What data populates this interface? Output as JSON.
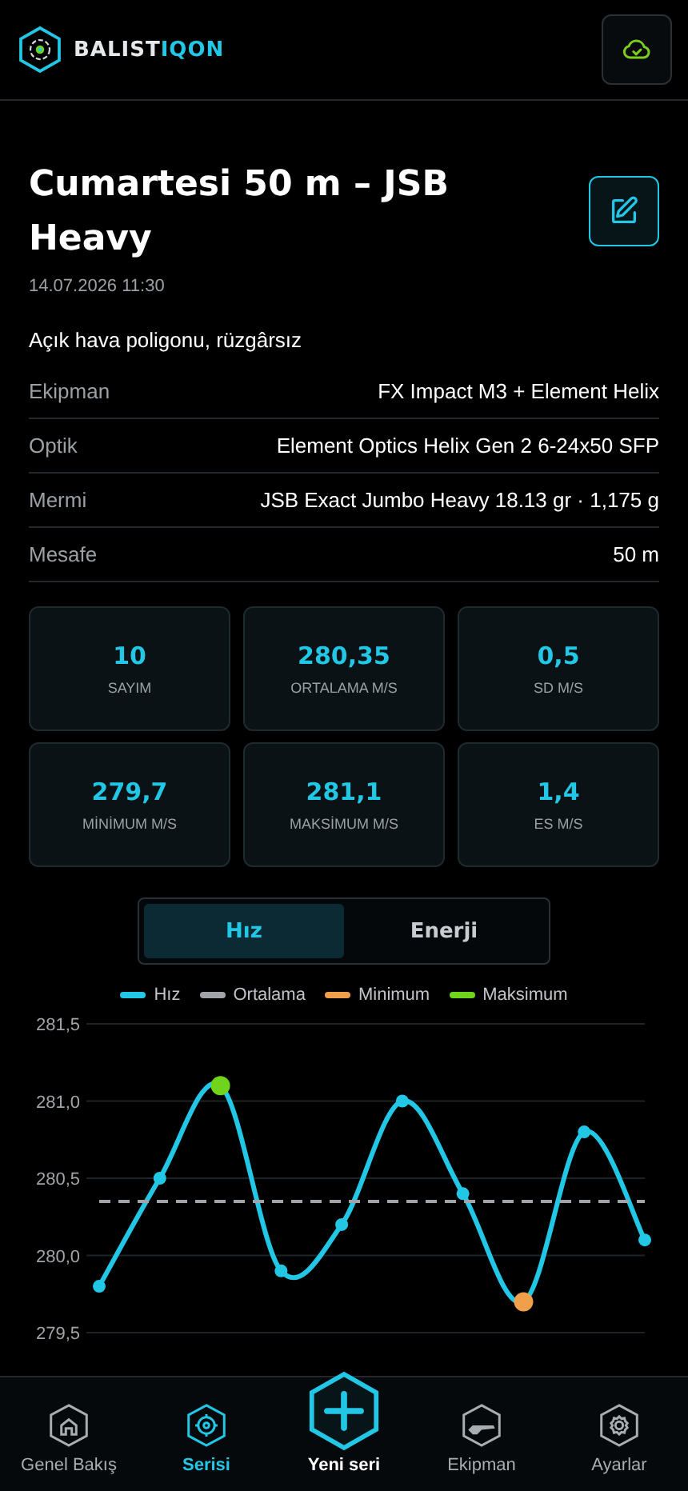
{
  "header": {
    "logo_text": "BALIST",
    "logo_accent": "IQON"
  },
  "session": {
    "title": "Cumartesi 50 m – JSB Heavy",
    "datetime": "14.07.2026 11:30",
    "note": "Açık hava poligonu, rüzgârsız"
  },
  "details": [
    {
      "label": "Ekipman",
      "value": "FX Impact M3 + Element Helix"
    },
    {
      "label": "Optik",
      "value": "Element Optics Helix Gen 2 6-24x50 SFP"
    },
    {
      "label": "Mermi",
      "value": "JSB Exact Jumbo Heavy 18.13 gr · 1,175 g"
    },
    {
      "label": "Mesafe",
      "value": "50 m"
    }
  ],
  "stats": [
    {
      "value": "10",
      "label": "SAYIM"
    },
    {
      "value": "280,35",
      "label": "ORTALAMA M/S"
    },
    {
      "value": "0,5",
      "label": "SD M/S"
    },
    {
      "value": "279,7",
      "label": "MİNİMUM M/S"
    },
    {
      "value": "281,1",
      "label": "MAKSİMUM M/S"
    },
    {
      "value": "1,4",
      "label": "ES M/S"
    }
  ],
  "toggle": [
    {
      "label": "Hız",
      "selected": true
    },
    {
      "label": "Enerji",
      "selected": false
    }
  ],
  "chart": {
    "chart_data": {
      "type": "line",
      "grid": true,
      "ylim": [
        279.5,
        281.5
      ],
      "yticks": [
        {
          "value": 281.5,
          "label": "281,5"
        },
        {
          "value": 281.0,
          "label": "281,0"
        },
        {
          "value": 280.5,
          "label": "280,5"
        },
        {
          "value": 280.0,
          "label": "280,0"
        },
        {
          "value": 279.5,
          "label": "279,5"
        }
      ],
      "series": [
        {
          "name": "Hız",
          "color": "#22c7e6",
          "line_style": "solid",
          "marker": "circle",
          "values": [
            279.8,
            280.5,
            281.1,
            279.9,
            280.2,
            281.0,
            280.4,
            279.7,
            280.8,
            280.1
          ]
        },
        {
          "name": "Ortalama",
          "color": "#a0a4a8",
          "line_style": "dashed",
          "values": [
            280.35,
            280.35,
            280.35,
            280.35,
            280.35,
            280.35,
            280.35,
            280.35,
            280.35,
            280.35
          ]
        },
        {
          "name": "Minimum",
          "color": "#f0a04b",
          "line_style": "none",
          "marker": "circle",
          "values": [
            null,
            null,
            null,
            null,
            null,
            null,
            null,
            279.7,
            null,
            null
          ]
        },
        {
          "name": "Maksimum",
          "color": "#6fd41a",
          "line_style": "none",
          "marker": "circle",
          "values": [
            null,
            null,
            281.1,
            null,
            null,
            null,
            null,
            null,
            null,
            null
          ]
        }
      ]
    }
  },
  "nav": [
    {
      "label": "Genel Bakış",
      "selected": false
    },
    {
      "label": "Serisi",
      "selected": true
    },
    {
      "label": "Yeni seri",
      "selected": false
    },
    {
      "label": "Ekipman",
      "selected": false
    },
    {
      "label": "Ayarlar",
      "selected": false
    }
  ]
}
